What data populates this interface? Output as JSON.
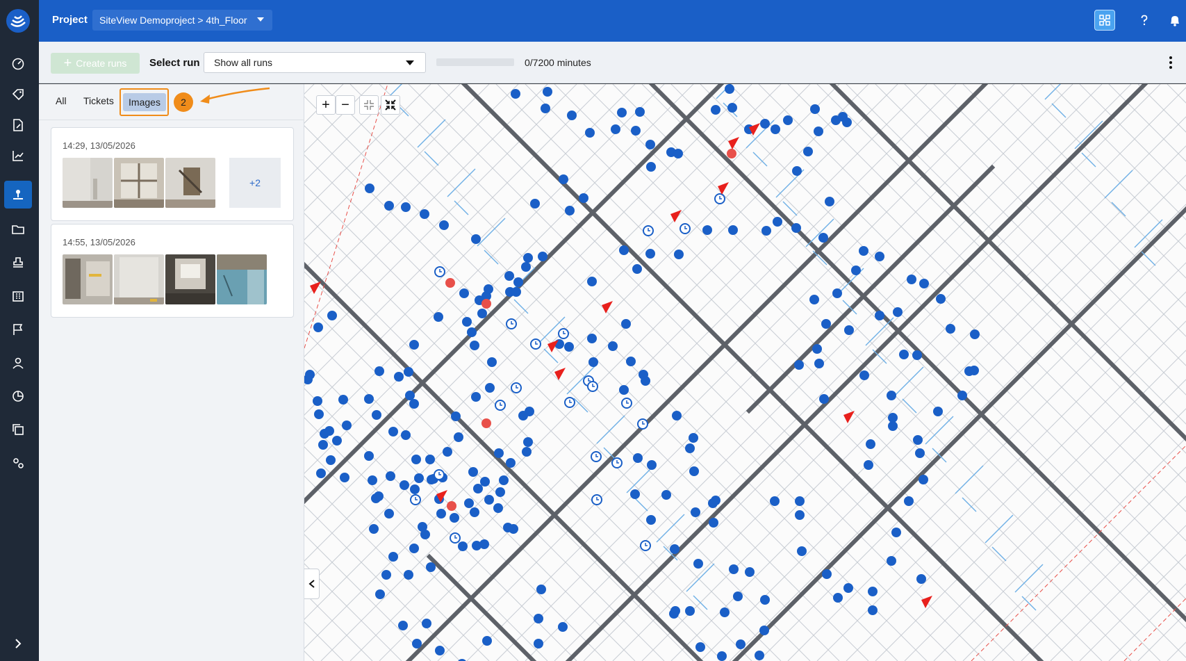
{
  "header": {
    "project_label": "Project",
    "project_selector": "SiteView Demoproject > 4th_Floor"
  },
  "rail": {
    "icons": [
      "dashboard-icon",
      "tag-icon",
      "document-edit-icon",
      "chart-icon",
      "map-pin-icon",
      "folder-icon",
      "stamp-icon",
      "building-icon",
      "flag-icon",
      "user-icon",
      "pie-chart-icon",
      "copy-icon",
      "settings-icon",
      "chevron-right-icon"
    ],
    "active": "map-pin-icon"
  },
  "toolbar": {
    "create_label": "Create runs",
    "select_label": "Select run",
    "run_selector": "Show all runs",
    "progress_fraction": 0,
    "minutes_text": "0/7200 minutes"
  },
  "panel": {
    "tabs": [
      {
        "label": "All"
      },
      {
        "label": "Tickets"
      },
      {
        "label": "Images"
      }
    ],
    "active_tab": "Images",
    "step_badge": "2",
    "cards": [
      {
        "time": "14:29, 13/05/2026",
        "more": "+2"
      },
      {
        "time": "14:55, 13/05/2026"
      }
    ]
  },
  "colors": {
    "topbar": "#1a5fc7",
    "rail": "#1f2937",
    "accent_orange": "#f08c1a",
    "marker_blue": "#1a5fc7",
    "marker_red": "#e8504a"
  }
}
